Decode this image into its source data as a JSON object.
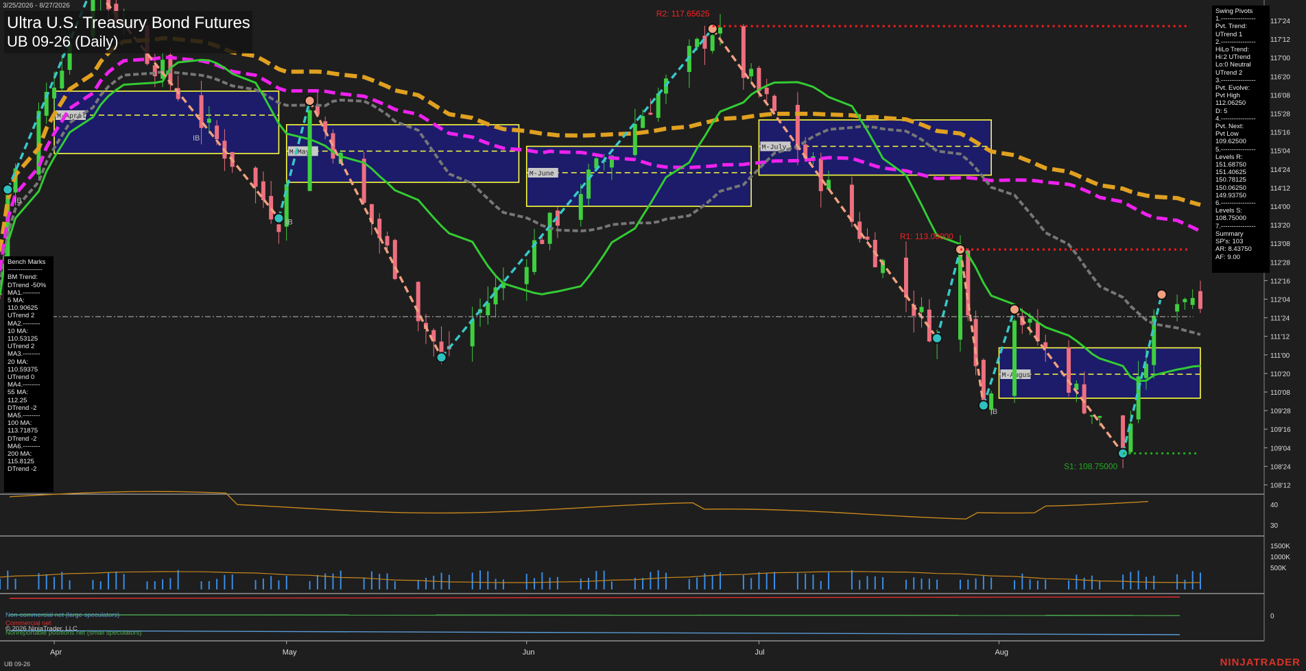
{
  "header": {
    "date_range": "3/25/2026 - 8/27/2026",
    "title_line1": "Ultra U.S. Treasury Bond Futures",
    "title_line2": "UB 09-26 (Daily)"
  },
  "bench_marks": [
    "Bench Marks",
    "----------------",
    "BM Trend:",
    "DTrend -50%",
    "MA1.--------",
    "5 MA:",
    "110.90625",
    "UTrend 2",
    "MA2.--------",
    "10 MA:",
    "110.53125",
    "UTrend 2",
    "MA3.--------",
    "20 MA:",
    "110.59375",
    "UTrend 0",
    "MA4.--------",
    "55 MA:",
    "112.25",
    "DTrend -2",
    "MA5.--------",
    "100 MA:",
    "113.71875",
    "DTrend -2",
    "MA6.--------",
    "200 MA:",
    "115.8125",
    "DTrend -2"
  ],
  "swing_pivots": [
    "Swing Pivots",
    "1.----------------",
    "Pvt. Trend:",
    "UTrend 1",
    "2.----------------",
    "HiLo Trend:",
    "Hi:2 UTrend",
    "Lo:0 Neutral",
    "UTrend 2",
    "3.----------------",
    "Pvt. Evolve:",
    "Pvt High",
    "112.06250",
    "D: 5",
    "4.----------------",
    "Pvt. Next:",
    "Pvt Low",
    "109.62500",
    "5.----------------",
    "Levels R:",
    "151.68750",
    "151.40625",
    "150.78125",
    "150.06250",
    "149.93750",
    "6.----------------",
    "Levels S:",
    "108.75000",
    "7.----------------",
    "Summary",
    "SP's: 103",
    "AR: 8.43750",
    "AF: 9.00"
  ],
  "footer": {
    "noncommercial": "Non-commercial net (large speculators)",
    "commercial": "Commercial net",
    "copyright": "© 2026 NinjaTrader, LLC",
    "nonreportable": "Nonreportable positions net (small speculators)",
    "symbol": "UB 09-26",
    "brand": "NINJATRADER"
  },
  "annotations": {
    "r2": "R2: 117.65625",
    "r1": "R1: 113.00000",
    "s1": "S1: 108.75000",
    "ib": "IB",
    "months": [
      "M-April",
      "M-May",
      "M-June",
      "M-July",
      "M-August"
    ]
  },
  "colors": {
    "background": "#1e1e1e",
    "up_candle": "#3fcf3f",
    "down_candle": "#ee6f7f",
    "ma_orange": "#e0a020",
    "ma_magenta": "#ee22ee",
    "ma_gray": "#777777",
    "ma_green": "#33cc33",
    "zigzag_up": "#38c8c8",
    "zigzag_down": "#f0a080",
    "resistance": "#ff1a1a",
    "support": "#22aa22"
  },
  "chart_data": {
    "type": "candlestick",
    "title": "UB 09-26 (Daily)",
    "x_labels": [
      "Apr",
      "May",
      "Jun",
      "Jul",
      "Aug"
    ],
    "y_ticks": [
      "117'24",
      "117'12",
      "117'00",
      "116'20",
      "116'08",
      "115'28",
      "115'16",
      "115'04",
      "114'24",
      "114'12",
      "114'00",
      "113'20",
      "113'08",
      "112'28",
      "112'16",
      "112'04",
      "111'24",
      "111'12",
      "111'00",
      "110'20",
      "110'08",
      "109'28",
      "109'16",
      "109'04",
      "108'24",
      "108'12"
    ],
    "ylim": [
      108.2,
      118.0
    ],
    "pivots": [
      {
        "date": "2026-03-26",
        "price": 114.25,
        "type": "low"
      },
      {
        "date": "2026-04-06",
        "price": 118.5,
        "type": "high"
      },
      {
        "date": "2026-04-30",
        "price": 113.65,
        "type": "low"
      },
      {
        "date": "2026-05-04",
        "price": 116.1,
        "type": "high"
      },
      {
        "date": "2026-05-21",
        "price": 110.75,
        "type": "low"
      },
      {
        "date": "2026-06-25",
        "price": 117.6,
        "type": "high"
      },
      {
        "date": "2026-07-24",
        "price": 111.15,
        "type": "low"
      },
      {
        "date": "2026-07-27",
        "price": 113.0,
        "type": "high"
      },
      {
        "date": "2026-07-30",
        "price": 109.75,
        "type": "low"
      },
      {
        "date": "2026-08-03",
        "price": 111.75,
        "type": "high"
      },
      {
        "date": "2026-08-17",
        "price": 108.75,
        "type": "low"
      },
      {
        "date": "2026-08-22",
        "price": 112.06,
        "type": "high"
      }
    ],
    "levels": [
      {
        "name": "R2",
        "value": 117.65625
      },
      {
        "name": "R1",
        "value": 113.0
      },
      {
        "name": "S1",
        "value": 108.75
      }
    ],
    "current_price_line": 111.6,
    "monthly_value_areas": [
      {
        "name": "M-April",
        "from": "2026-04-01",
        "to": "2026-04-30",
        "high": 116.3,
        "low": 115.0,
        "mid": 115.8
      },
      {
        "name": "M-May",
        "from": "2026-05-01",
        "to": "2026-05-31",
        "high": 115.6,
        "low": 114.4,
        "mid": 115.05
      },
      {
        "name": "M-June",
        "from": "2026-06-01",
        "to": "2026-06-30",
        "high": 115.15,
        "low": 113.9,
        "mid": 114.6
      },
      {
        "name": "M-July",
        "from": "2026-07-01",
        "to": "2026-07-31",
        "high": 115.7,
        "low": 114.55,
        "mid": 115.15
      },
      {
        "name": "M-August",
        "from": "2026-08-01",
        "to": "2026-08-27",
        "high": 110.95,
        "low": 109.9,
        "mid": 110.4
      }
    ],
    "moving_averages": [
      {
        "name": "200 MA",
        "value": 115.8125
      },
      {
        "name": "100 MA",
        "value": 113.71875
      },
      {
        "name": "55 MA",
        "value": 112.25
      },
      {
        "name": "20 MA",
        "value": 110.59375
      }
    ],
    "oscillator": {
      "ticks": [
        "40",
        "30"
      ],
      "ylim": [
        25,
        45
      ]
    },
    "volume": {
      "ticks": [
        "1500K",
        "1000K",
        "500K"
      ],
      "ylim": [
        0,
        1800000
      ]
    },
    "cot": {
      "ticks": [
        "0"
      ]
    }
  }
}
